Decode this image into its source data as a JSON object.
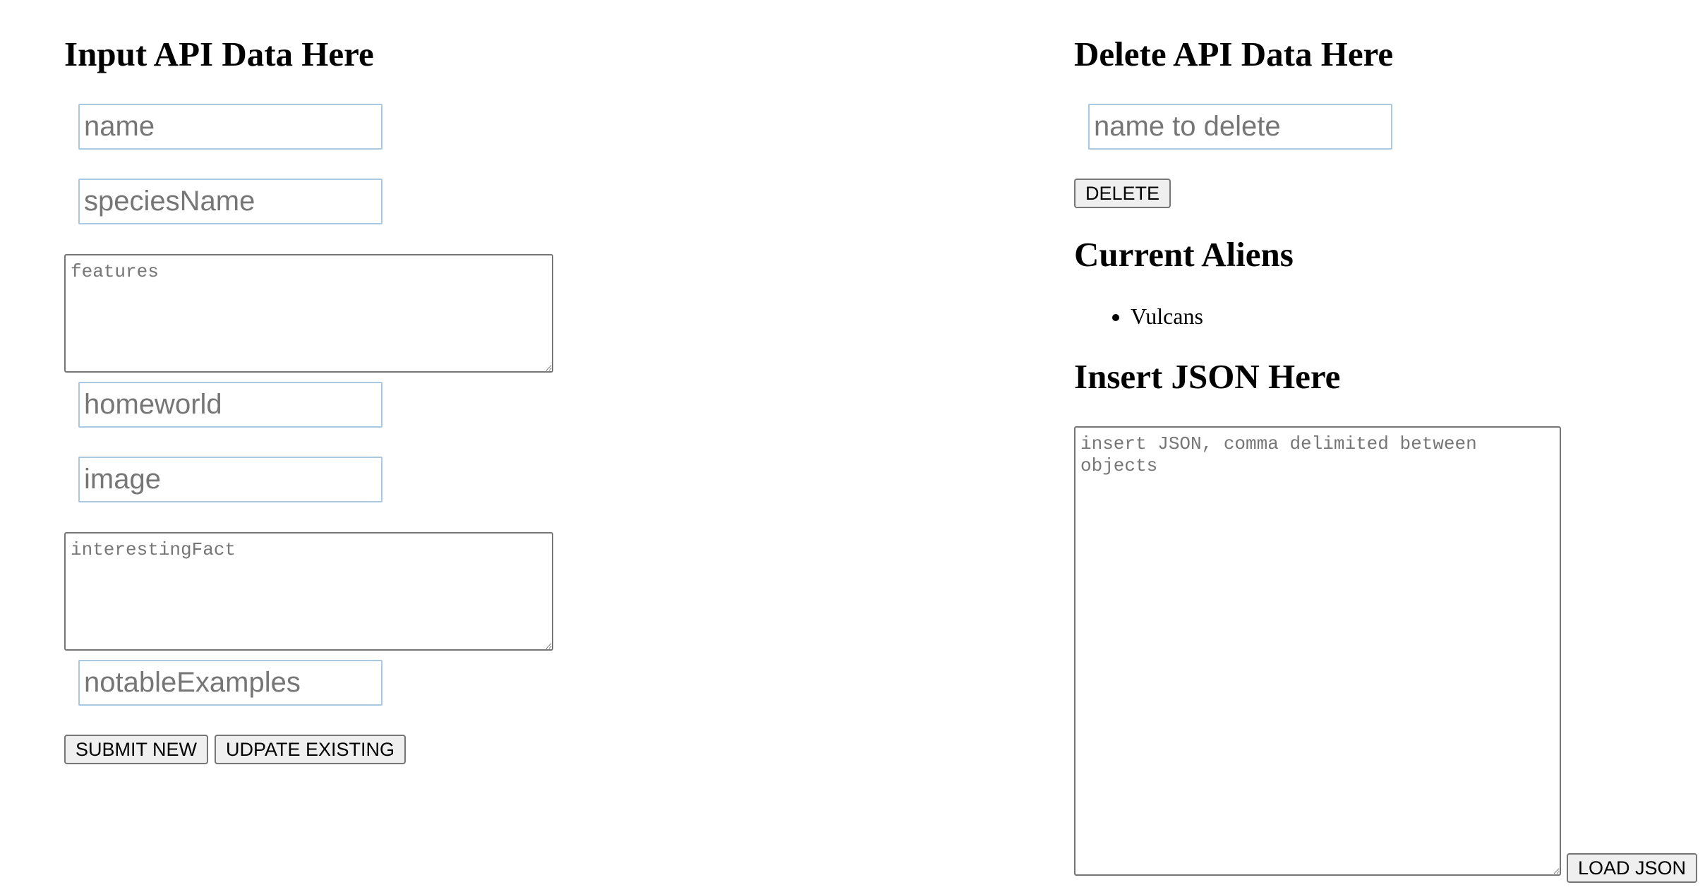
{
  "input_section": {
    "heading": "Input API Data Here",
    "fields": {
      "name_placeholder": "name",
      "species_name_placeholder": "speciesName",
      "features_placeholder": "features",
      "homeworld_placeholder": "homeworld",
      "image_placeholder": "image",
      "interesting_fact_placeholder": "interestingFact",
      "notable_examples_placeholder": "notableExamples"
    },
    "submit_label": "SUBMIT NEW",
    "update_label": "UDPATE EXISTING"
  },
  "delete_section": {
    "heading": "Delete API Data Here",
    "name_placeholder": "name to delete",
    "delete_label": "DELETE"
  },
  "aliens_section": {
    "heading": "Current Aliens",
    "items": [
      "Vulcans"
    ]
  },
  "json_section": {
    "heading": "Insert JSON Here",
    "textarea_placeholder": "insert JSON, comma delimited between objects",
    "load_label": "LOAD JSON"
  }
}
